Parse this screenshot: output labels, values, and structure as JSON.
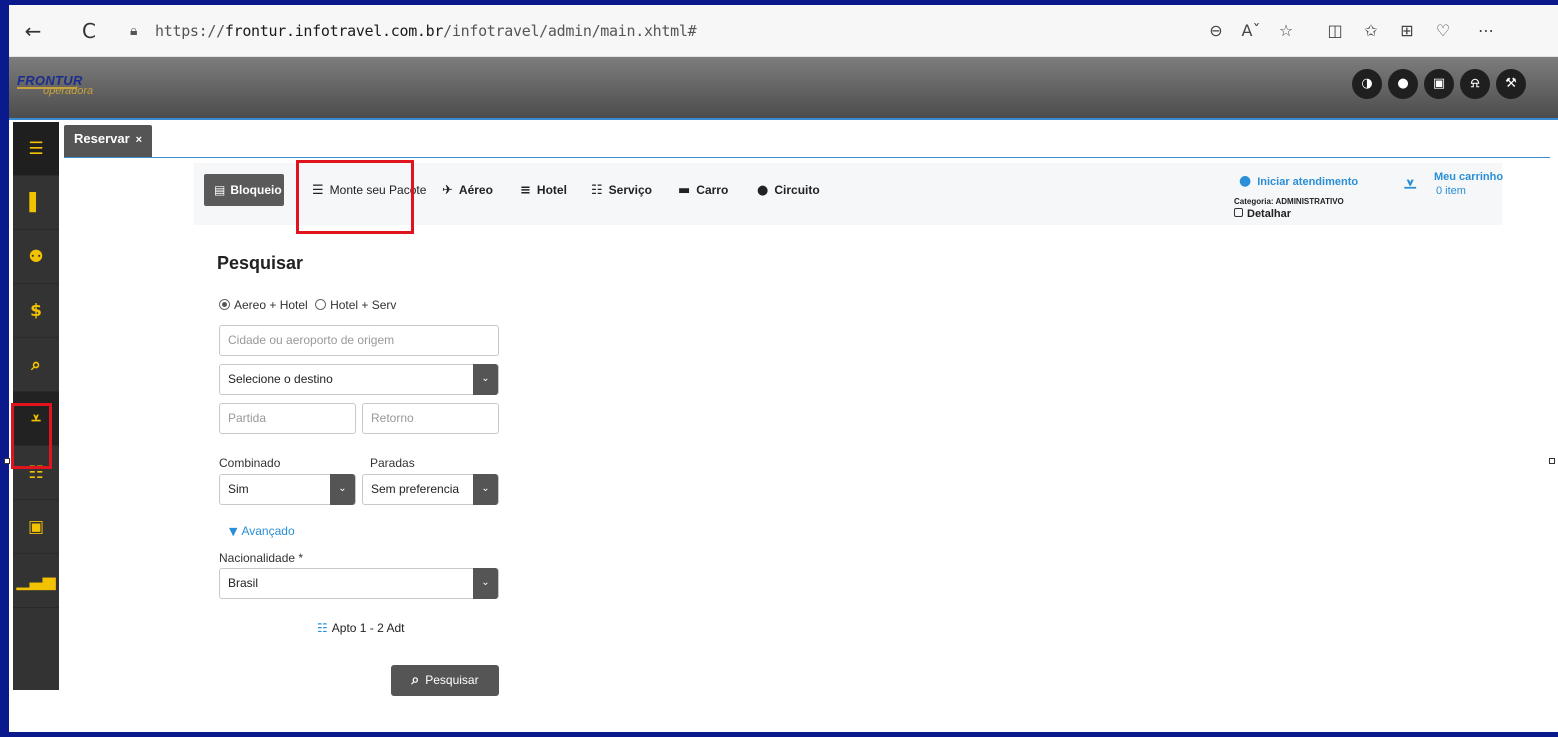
{
  "browser": {
    "back": "←",
    "reload": "C",
    "url_prefix": "https://",
    "url_domain": "frontur.infotravel.com.br",
    "url_path": "/infotravel/admin/main.xhtml#",
    "toolbar_icons": [
      "zoom-icon",
      "read-aloud-icon",
      "favorite-star-icon",
      "split-screen-icon",
      "favorites-list-icon",
      "collections-icon",
      "health-icon",
      "more-icon"
    ]
  },
  "app": {
    "logo_line1": "FRONTUR",
    "logo_line2": "operadora"
  },
  "tab": {
    "label": "Reservar",
    "close": "×"
  },
  "menu": {
    "bloqueio": "Bloqueio",
    "monte": "Monte seu Pacote",
    "aereo": "Aéreo",
    "hotel": "Hotel",
    "servico": "Serviço",
    "carro": "Carro",
    "circuito": "Circuito",
    "iniciar": "Iniciar atendimento",
    "categoria": "Categoria: ADMINISTRATIVO",
    "detalhar": "Detalhar",
    "carrinho": "Meu carrinho",
    "carrinho_count": "0 item"
  },
  "form": {
    "title": "Pesquisar",
    "radio1": "Aereo + Hotel",
    "radio2": "Hotel + Serv",
    "origem_placeholder": "Cidade ou aeroporto de origem",
    "destino": "Selecione o destino",
    "partida_placeholder": "Partida",
    "retorno_placeholder": "Retorno",
    "combinado_label": "Combinado",
    "combinado_value": "Sim",
    "paradas_label": "Paradas",
    "paradas_value": "Sem preferencia",
    "avancado": "Avançado",
    "nacionalidade_label": "Nacionalidade *",
    "nacionalidade_value": "Brasil",
    "apto": "Apto 1 - 2 Adt",
    "pesquisar_button": "Pesquisar"
  },
  "colors": {
    "frame": "#0a1a8c",
    "accent": "#2a8fd6",
    "sidebar_icon": "#f2c200",
    "highlight": "#e0141c"
  }
}
